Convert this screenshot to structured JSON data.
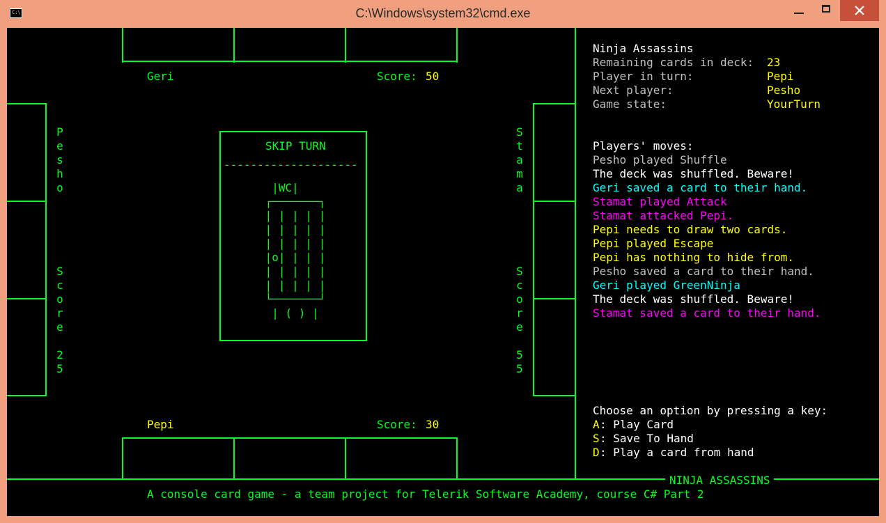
{
  "window": {
    "title": "C:\\Windows\\system32\\cmd.exe",
    "icon": "C:\\."
  },
  "players": {
    "top": {
      "name": "Geri",
      "score_label": "Score:",
      "score": "50"
    },
    "bottom": {
      "name": "Pepi",
      "score_label": "Score:",
      "score": "30"
    },
    "left": {
      "name": "Pesho",
      "score_label": "Score",
      "score": "25"
    },
    "right": {
      "name": "Stama",
      "score_label": "Score",
      "score": "55"
    }
  },
  "center_card": {
    "title": "SKIP TURN",
    "divider": "--------------------",
    "art": [
      "  |WC|",
      " ┌───────┐",
      " | | | | |",
      " | | | | |",
      " | | | | |",
      " |o| | | |",
      " | | | | |",
      " | | | | |",
      " └───────┘",
      "  | ( ) |"
    ]
  },
  "info": {
    "game_title": "Ninja Assassins",
    "remaining_label": "Remaining cards in deck:",
    "remaining_value": "23",
    "turn_label": "Player in turn:",
    "turn_value": "Pepi",
    "next_label": "Next player:",
    "next_value": "Pesho",
    "state_label": "Game state:",
    "state_value": "YourTurn"
  },
  "moves": {
    "heading": "Players' moves:",
    "lines": [
      {
        "text": "Pesho played Shuffle",
        "color": "gray"
      },
      {
        "text": "The deck was shuffled. Beware!",
        "color": "white"
      },
      {
        "text": "Geri saved a card to their hand.",
        "color": "cyan"
      },
      {
        "text": "Stamat played Attack",
        "color": "magenta"
      },
      {
        "text": "Stamat attacked Pepi.",
        "color": "magenta"
      },
      {
        "text": "Pepi needs to draw two cards.",
        "color": "yellow"
      },
      {
        "text": "Pepi played Escape",
        "color": "yellow"
      },
      {
        "text": "Pepi has nothing to hide from.",
        "color": "yellow"
      },
      {
        "text": "Pesho saved a card to their hand.",
        "color": "gray"
      },
      {
        "text": "Geri played GreenNinja",
        "color": "cyan"
      },
      {
        "text": "The deck was shuffled. Beware!",
        "color": "white"
      },
      {
        "text": "Stamat saved a card to their hand.",
        "color": "magenta"
      }
    ]
  },
  "options": {
    "prompt": "Choose an option by pressing a key:",
    "items": [
      {
        "key": "A",
        "label": ": Play Card"
      },
      {
        "key": "S",
        "label": ": Save To Hand"
      },
      {
        "key": "D",
        "label": ": Play a card from hand"
      }
    ]
  },
  "footer": {
    "banner": "NINJA ASSASSINS",
    "tagline": "A console card game - a team project for Telerik Software Academy, course C# Part 2"
  },
  "colors": {
    "green": "#00ff1e",
    "yellow": "#ffff00",
    "cyan": "#00ffff",
    "magenta": "#ff00ff",
    "gray": "#c0c0c0",
    "white": "#ffffff",
    "titlebar": "#f0a07e"
  }
}
